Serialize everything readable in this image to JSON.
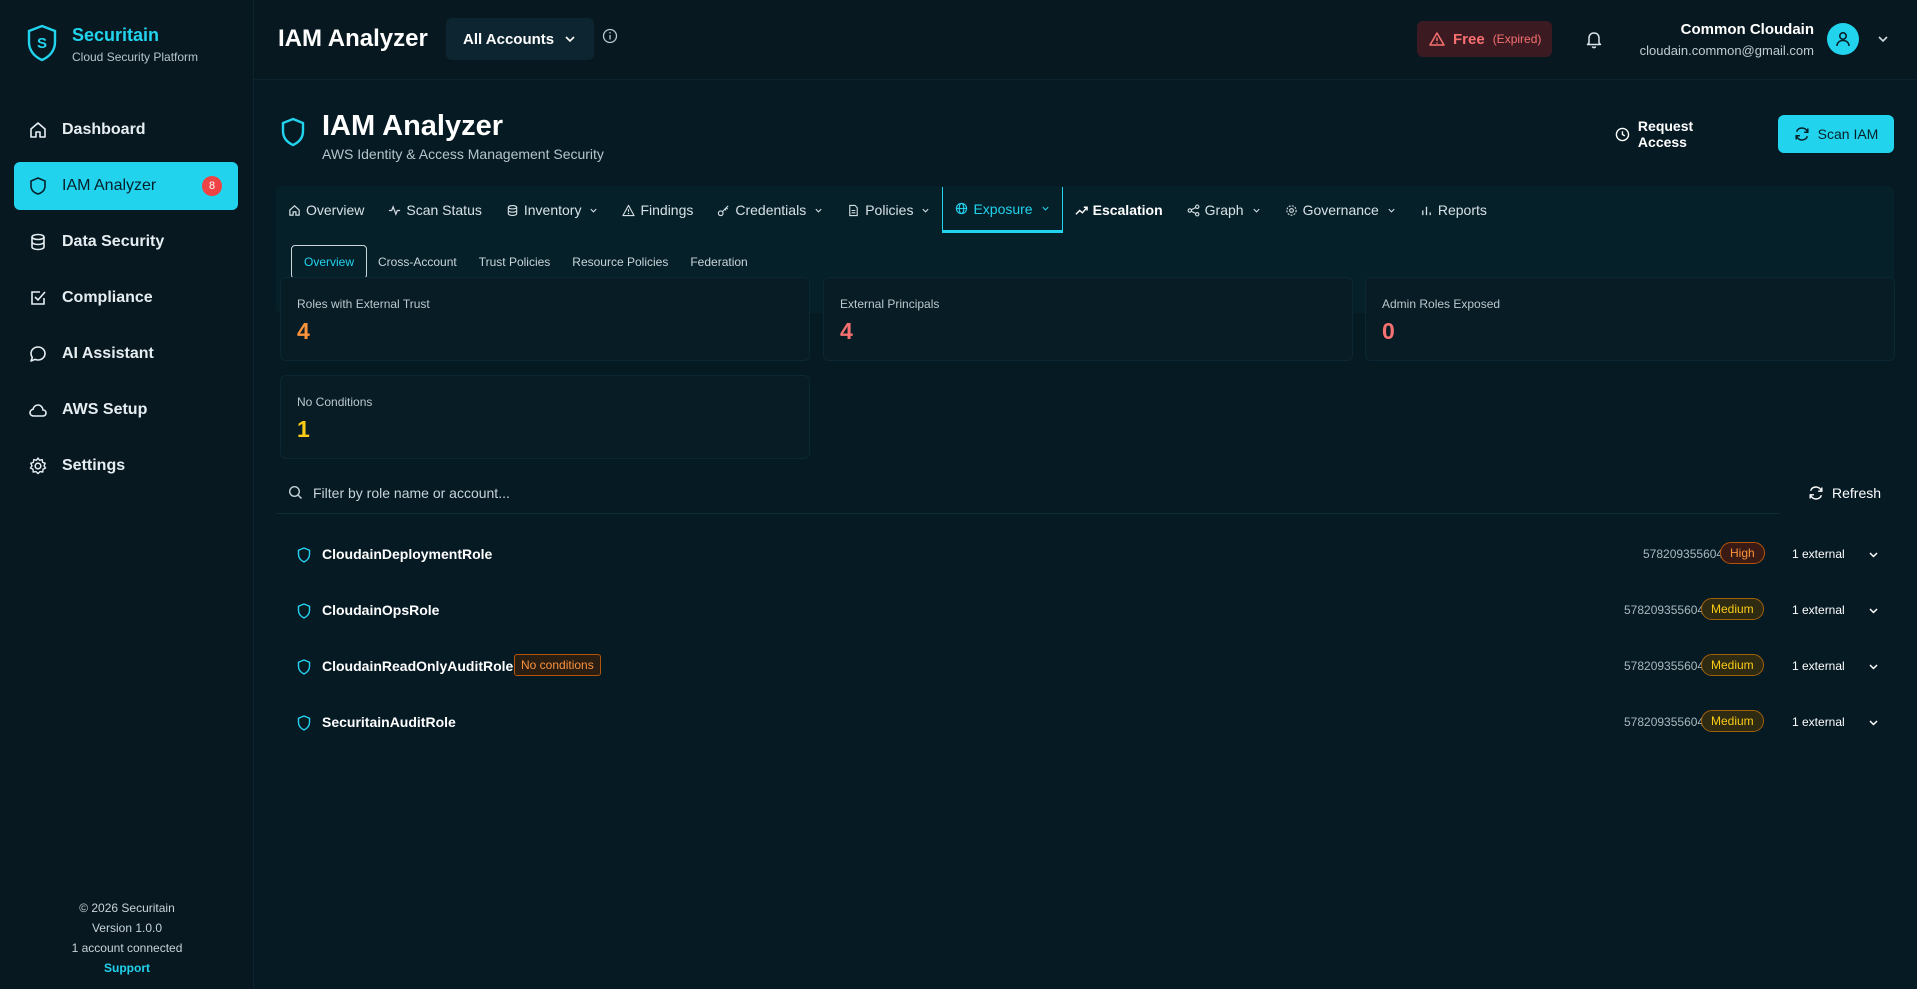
{
  "brand": {
    "name": "Securitain",
    "subtitle": "Cloud Security Platform"
  },
  "sidebar": {
    "items": [
      {
        "label": "Dashboard",
        "icon": "home-icon"
      },
      {
        "label": "IAM Analyzer",
        "icon": "shield-icon",
        "badge": "8",
        "active": true
      },
      {
        "label": "Data Security",
        "icon": "database-icon"
      },
      {
        "label": "Compliance",
        "icon": "checkbox-icon"
      },
      {
        "label": "AI Assistant",
        "icon": "chat-icon"
      },
      {
        "label": "AWS Setup",
        "icon": "cloud-icon"
      },
      {
        "label": "Settings",
        "icon": "gear-icon"
      }
    ],
    "footer": {
      "copyright": "© 2026 Securitain",
      "version": "Version 1.0.0",
      "accounts": "1 account connected",
      "support": "Support"
    }
  },
  "topbar": {
    "title": "IAM Analyzer",
    "account_select": "All Accounts",
    "plan": "Free",
    "plan_status": "(Expired)",
    "user_name": "Common Cloudain",
    "user_email": "cloudain.common@gmail.com"
  },
  "page": {
    "title": "IAM Analyzer",
    "subtitle": "AWS Identity & Access Management Security",
    "request_access": "Request Access",
    "scan": "Scan IAM"
  },
  "tabs": [
    {
      "label": "Overview",
      "icon": "home-icon"
    },
    {
      "label": "Scan Status",
      "icon": "activity-icon"
    },
    {
      "label": "Inventory",
      "icon": "database-icon",
      "dropdown": true
    },
    {
      "label": "Findings",
      "icon": "warning-icon"
    },
    {
      "label": "Credentials",
      "icon": "key-icon",
      "dropdown": true
    },
    {
      "label": "Policies",
      "icon": "document-icon",
      "dropdown": true
    },
    {
      "label": "Exposure",
      "icon": "globe-icon",
      "dropdown": true,
      "active": true
    },
    {
      "label": "Escalation",
      "icon": "trending-up-icon"
    },
    {
      "label": "Graph",
      "icon": "share-icon",
      "dropdown": true
    },
    {
      "label": "Governance",
      "icon": "gear-icon",
      "dropdown": true
    },
    {
      "label": "Reports",
      "icon": "bar-chart-icon"
    }
  ],
  "subtabs": [
    "Overview",
    "Cross-Account",
    "Trust Policies",
    "Resource Policies",
    "Federation"
  ],
  "stats": [
    {
      "label": "Roles with External Trust",
      "value": "4",
      "color": "#fb923c"
    },
    {
      "label": "External Principals",
      "value": "4",
      "color": "#f87171"
    },
    {
      "label": "Admin Roles Exposed",
      "value": "0",
      "color": "#f87171"
    },
    {
      "label": "No Conditions",
      "value": "1",
      "color": "#facc15"
    }
  ],
  "filter": {
    "placeholder": "Filter by role name or account...",
    "refresh": "Refresh"
  },
  "roles": [
    {
      "name": "CloudainDeploymentRole",
      "account": "578209355604",
      "severity": "High",
      "external": "1 external",
      "tag": ""
    },
    {
      "name": "CloudainOpsRole",
      "account": "578209355604",
      "severity": "Medium",
      "external": "1 external",
      "tag": ""
    },
    {
      "name": "CloudainReadOnlyAuditRole",
      "account": "578209355604",
      "severity": "Medium",
      "external": "1 external",
      "tag": "No conditions"
    },
    {
      "name": "SecuritainAuditRole",
      "account": "578209355604",
      "severity": "Medium",
      "external": "1 external",
      "tag": ""
    }
  ],
  "colors": {
    "accent": "#22d3ee",
    "background": "#061a24",
    "sidebar": "#071820"
  }
}
